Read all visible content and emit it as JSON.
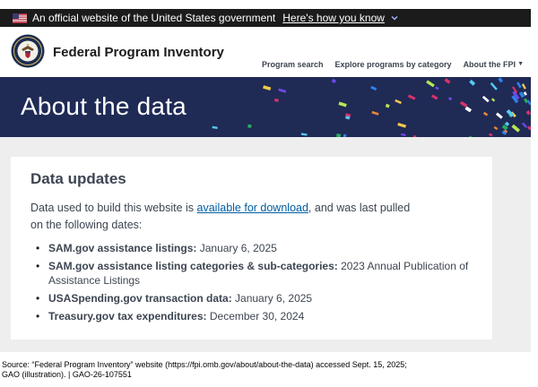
{
  "gov_banner": {
    "official_text": "An official website of the United States government",
    "how_link": "Here's how you know"
  },
  "header": {
    "site_title": "Federal Program Inventory",
    "nav": [
      "Program search",
      "Explore programs by category",
      "About the FPI"
    ]
  },
  "hero": {
    "title": "About the data"
  },
  "data_updates": {
    "title": "Data updates",
    "intro_before": "Data used to build this website is ",
    "intro_link": "available for download",
    "intro_after": ", and was last pulled on the following dates:",
    "items": [
      {
        "label": "SAM.gov assistance listings:",
        "value": " January 6, 2025"
      },
      {
        "label": "SAM.gov assistance listing categories & sub-categories:",
        "value": " 2023 Annual Publication of Assistance Listings"
      },
      {
        "label": "USASpending.gov transaction data:",
        "value": " January 6, 2025"
      },
      {
        "label": "Treasury.gov tax expenditures:",
        "value": " December 30, 2024"
      }
    ]
  },
  "source": {
    "line1": "Source: “Federal Program Inventory” website (https://fpi.omb.gov/about/about-the-data) accessed Sept. 15, 2025;",
    "line2": "GAO (illustration).  |  GAO-26-107551"
  },
  "colors": {
    "banner_bg": "#1b1b1b",
    "hero_bg": "#1f2a55",
    "link": "#005ea2",
    "content_bg": "#eeeeee"
  }
}
